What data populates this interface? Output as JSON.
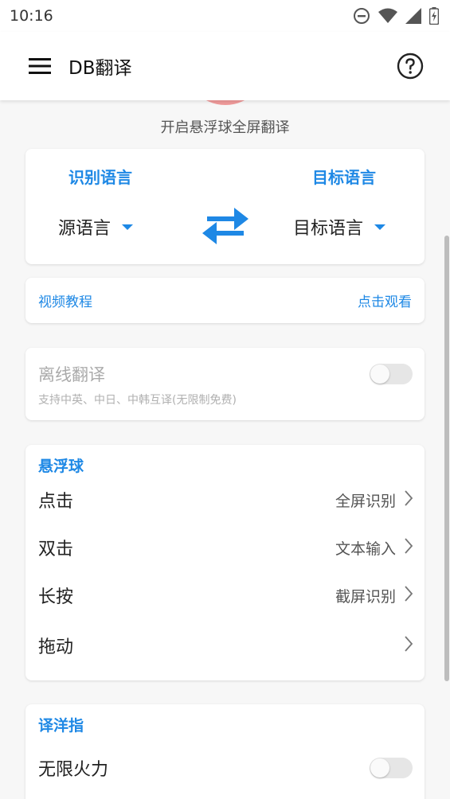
{
  "status_bar": {
    "time": "10:16",
    "icons": [
      "do-not-disturb-icon",
      "wifi-icon",
      "signal-icon",
      "battery-charging-icon"
    ]
  },
  "app_bar": {
    "title": "DB翻译",
    "menu_icon": "hamburger-menu-icon",
    "help_icon": "help-circle-icon"
  },
  "floating_ball": {
    "caption": "开启悬浮球全屏翻译",
    "color": "#ef9a9a"
  },
  "language": {
    "source_label": "识别语言",
    "target_label": "目标语言",
    "source_value": "源语言",
    "target_value": "目标语言",
    "swap_icon": "swap-arrows-icon"
  },
  "tutorial": {
    "label": "视频教程",
    "action": "点击观看"
  },
  "offline": {
    "title": "离线翻译",
    "subtitle": "支持中英、中日、中韩互译(无限制免费)",
    "enabled": false
  },
  "float_section": {
    "title": "悬浮球",
    "rows": [
      {
        "label": "点击",
        "value": "全屏识别"
      },
      {
        "label": "双击",
        "value": "文本输入"
      },
      {
        "label": "长按",
        "value": "截屏识别"
      },
      {
        "label": "拖动",
        "value": ""
      }
    ]
  },
  "finger_section": {
    "title": "译洋指",
    "rows": [
      {
        "label": "无限火力",
        "enabled": false
      }
    ]
  },
  "colors": {
    "accent": "#1e88e5",
    "background": "#f7f7f7",
    "card": "#ffffff"
  }
}
